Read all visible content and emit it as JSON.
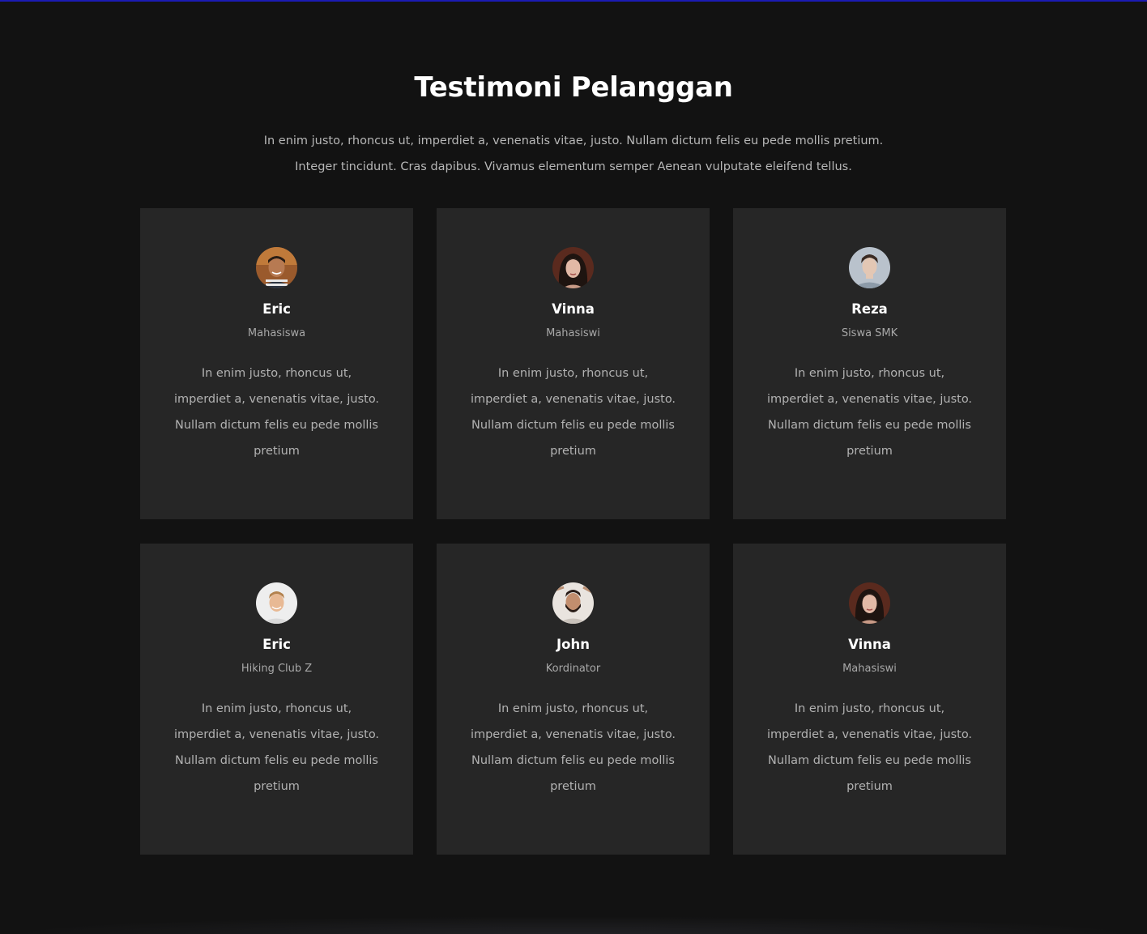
{
  "header": {
    "title": "Testimoni Pelanggan",
    "intro": "In enim justo, rhoncus ut, imperdiet a, venenatis vitae, justo. Nullam dictum felis eu pede mollis pretium. Integer tincidunt. Cras dapibus. Vivamus elementum semper Aenean vulputate eleifend tellus."
  },
  "colors": {
    "background": "#121212",
    "card": "#262626",
    "top_accent": "#1b1bb3"
  },
  "testimonials": [
    {
      "name": "Eric",
      "role": "Mahasiswa",
      "quote": "In enim justo, rhoncus ut, imperdiet a, venenatis vitae, justo. Nullam dictum felis eu pede mollis pretium",
      "avatar_icon": "man-smiling-avatar"
    },
    {
      "name": "Vinna",
      "role": "Mahasiswi",
      "quote": "In enim justo, rhoncus ut, imperdiet a, venenatis vitae, justo. Nullam dictum felis eu pede mollis pretium",
      "avatar_icon": "woman-dark-hair-avatar"
    },
    {
      "name": "Reza",
      "role": "Siswa SMK",
      "quote": "In enim justo, rhoncus ut, imperdiet a, venenatis vitae, justo. Nullam dictum felis eu pede mollis pretium",
      "avatar_icon": "young-man-avatar"
    },
    {
      "name": "Eric",
      "role": "Hiking Club Z",
      "quote": "In enim justo, rhoncus ut, imperdiet a, venenatis vitae, justo. Nullam dictum felis eu pede mollis pretium",
      "avatar_icon": "blond-man-avatar"
    },
    {
      "name": "John",
      "role": "Kordinator",
      "quote": "In enim justo, rhoncus ut, imperdiet a, venenatis vitae, justo. Nullam dictum felis eu pede mollis pretium",
      "avatar_icon": "bearded-man-avatar"
    },
    {
      "name": "Vinna",
      "role": "Mahasiswi",
      "quote": "In enim justo, rhoncus ut, imperdiet a, venenatis vitae, justo. Nullam dictum felis eu pede mollis pretium",
      "avatar_icon": "woman-dark-hair-avatar"
    }
  ]
}
